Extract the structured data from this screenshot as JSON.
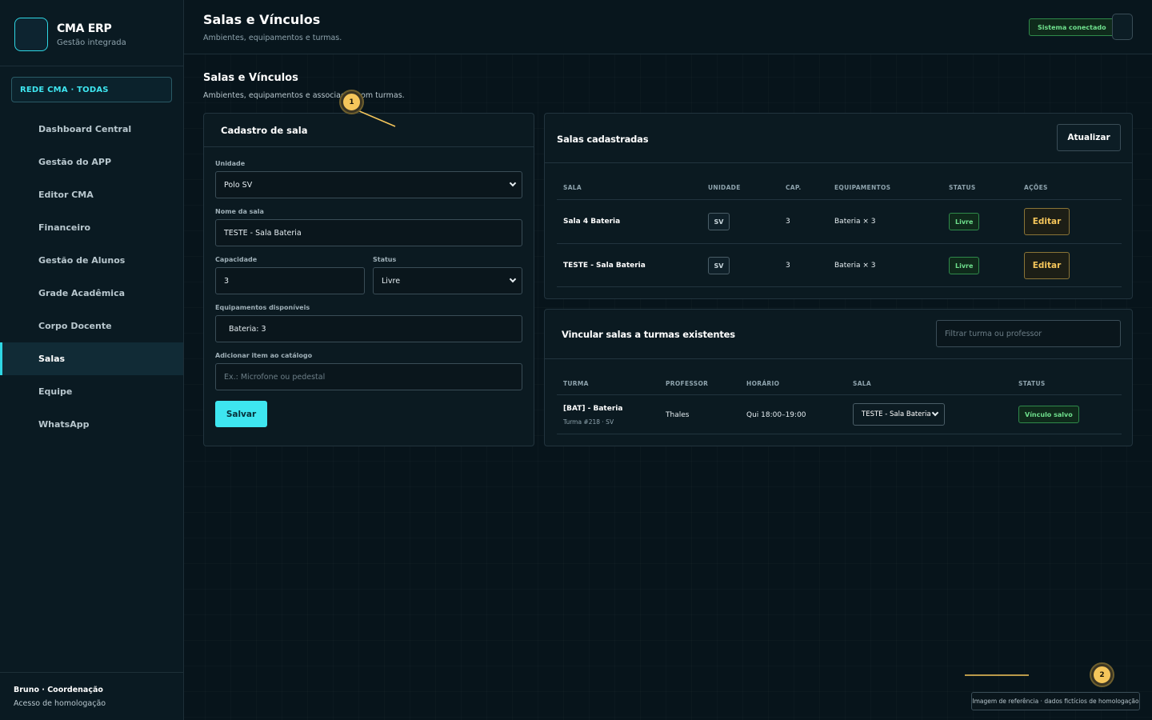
{
  "brand": {
    "title": "CMA ERP",
    "subtitle": "Gestão integrada"
  },
  "network": {
    "label": "REDE CMA · TODAS"
  },
  "nav": {
    "items": [
      {
        "label": "Dashboard Central"
      },
      {
        "label": "Gestão do APP"
      },
      {
        "label": "Editor CMA"
      },
      {
        "label": "Financeiro"
      },
      {
        "label": "Gestão de Alunos"
      },
      {
        "label": "Grade Acadêmica"
      },
      {
        "label": "Corpo Docente"
      },
      {
        "label": "Salas",
        "active": true
      },
      {
        "label": "Equipe"
      },
      {
        "label": "WhatsApp"
      }
    ]
  },
  "user": {
    "name": "Bruno · Coordenação",
    "role": "Acesso de homologação"
  },
  "header": {
    "title": "Salas e Vínculos",
    "subtitle": "Ambientes, equipamentos e turmas.",
    "connection_status": "Sistema conectado"
  },
  "section": {
    "title": "Salas e Vínculos",
    "subtitle": "Ambientes, equipamentos e associação com turmas."
  },
  "form": {
    "title": "Cadastro de sala",
    "unit_label": "Unidade",
    "unit_value": "Polo SV",
    "name_label": "Nome da sala",
    "name_value": "TESTE - Sala Bateria",
    "capacity_label": "Capacidade",
    "capacity_value": "3",
    "status_label": "Status",
    "status_value": "Livre",
    "equipment_label": "Equipamentos disponíveis",
    "equipment_value": "Bateria: 3",
    "catalog_label": "Adicionar item ao catálogo",
    "catalog_placeholder": "Ex.: Microfone ou pedestal",
    "save_label": "Salvar"
  },
  "rooms": {
    "title": "Salas cadastradas",
    "refresh_label": "Atualizar",
    "columns": [
      "SALA",
      "UNIDADE",
      "CAP.",
      "EQUIPAMENTOS",
      "STATUS",
      "AÇÕES"
    ],
    "rows": [
      {
        "name": "Sala 4 Bateria",
        "unit": "SV",
        "capacity": "3",
        "equipment": "Bateria × 3",
        "status": "Livre",
        "action": "Editar"
      },
      {
        "name": "TESTE - Sala Bateria",
        "unit": "SV",
        "capacity": "3",
        "equipment": "Bateria × 3",
        "status": "Livre",
        "action": "Editar"
      }
    ]
  },
  "links": {
    "title": "Vincular salas a turmas existentes",
    "filter_placeholder": "Filtrar turma ou professor",
    "columns": [
      "TURMA",
      "PROFESSOR",
      "HORÁRIO",
      "SALA",
      "STATUS"
    ],
    "rows": [
      {
        "class_name": "[BAT] - Bateria",
        "class_sub": "Turma #218 · SV",
        "teacher": "Thales",
        "schedule": "Qui 18:00–19:00",
        "room": "TESTE - Sala Bateria",
        "status": "Vínculo salvo"
      }
    ]
  },
  "annotations": {
    "marker_1": "1",
    "marker_2": "2",
    "note": "Imagem de referência · dados fictícios de homologação"
  },
  "colors": {
    "accent": "#3ee6f0",
    "success": "#6fe08d",
    "warning": "#f5c65b",
    "background": "#07141b"
  }
}
